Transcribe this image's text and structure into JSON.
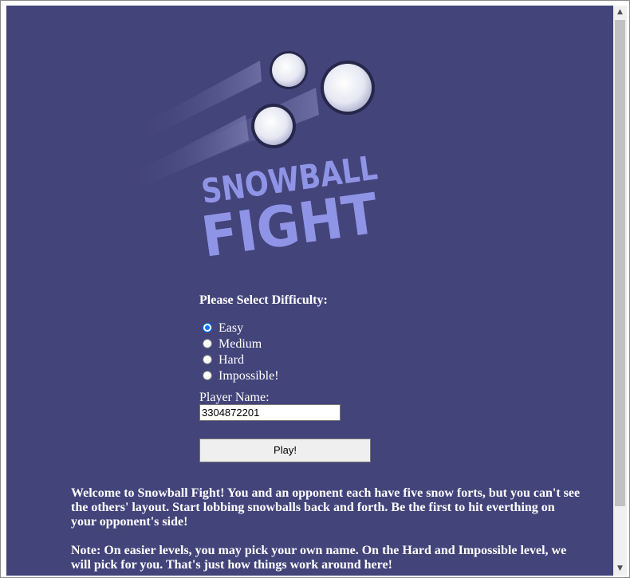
{
  "logo": {
    "line1": "SNOWBALL",
    "line2": "FIGHT",
    "colors": {
      "text": "#8f94e6",
      "snow": "#ffffff",
      "snow_shade": "#c9cbe6",
      "outline": "#26274a"
    }
  },
  "difficulty": {
    "heading": "Please Select Difficulty:",
    "options": [
      "Easy",
      "Medium",
      "Hard",
      "Impossible!"
    ],
    "selected": "Easy"
  },
  "player": {
    "label": "Player Name:",
    "value": "3304872201"
  },
  "play_button": {
    "label": "Play!"
  },
  "description": {
    "paragraph1": "Welcome to Snowball Fight! You and an opponent each have five snow forts, but you can't see the others' layout. Start lobbing snowballs back and forth. Be the first to hit everthing on your opponent's side!",
    "paragraph2": "Note: On easier levels, you may pick your own name. On the Hard and Impossible level, we will pick for you. That's just how things work around here!"
  },
  "colors": {
    "page_background": "#43447a",
    "accent": "#0075ff"
  }
}
